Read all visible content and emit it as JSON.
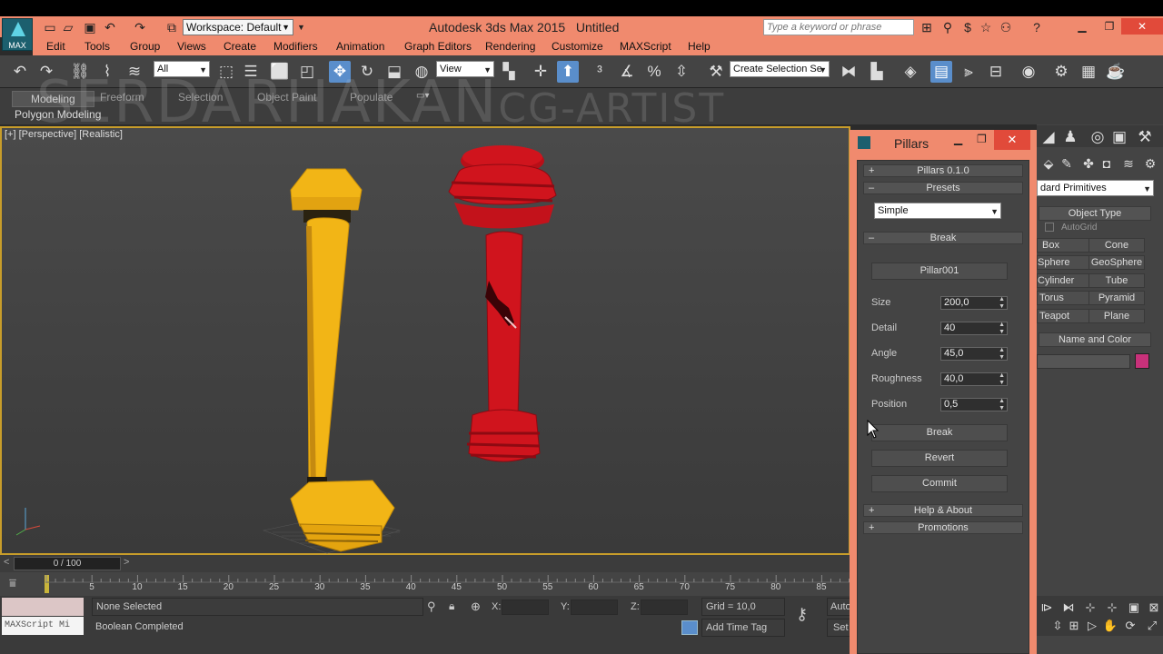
{
  "window": {
    "app_title": "Autodesk 3ds Max  2015",
    "doc_title": "Untitled",
    "logo_text": "MAX",
    "workspace": "Workspace: Default",
    "search_placeholder": "Type a keyword or phrase"
  },
  "menu": [
    "Edit",
    "Tools",
    "Group",
    "Views",
    "Create",
    "Modifiers",
    "Animation",
    "Graph Editors",
    "Rendering",
    "Customize",
    "MAXScript",
    "Help"
  ],
  "toolbar": {
    "selection_filter": "All",
    "ref_coord": "View",
    "named_selection": "Create Selection Se"
  },
  "ribbon": {
    "tabs": [
      "Modeling",
      "Freeform",
      "Selection",
      "Object Paint",
      "Populate"
    ],
    "subtab": "Polygon Modeling"
  },
  "watermark": {
    "main": "SERDARHAKAN",
    "sub": "CG-ARTIST"
  },
  "viewport": {
    "label": "[+] [Perspective] [Realistic]"
  },
  "timeline": {
    "frame_label": "0 / 100",
    "ticks": [
      "0",
      "5",
      "10",
      "15",
      "20",
      "25",
      "30",
      "35",
      "40",
      "45",
      "50",
      "55",
      "60",
      "65",
      "70",
      "75",
      "80",
      "85"
    ]
  },
  "status": {
    "selection": "None Selected",
    "message": "Boolean Completed",
    "x_label": "X:",
    "y_label": "Y:",
    "z_label": "Z:",
    "grid": "Grid = 10,0",
    "add_time_tag": "Add Time Tag",
    "auto": "Auto",
    "set": "Set",
    "maxscript": "MAXScript Mi"
  },
  "dialog": {
    "title": "Pillars",
    "rollouts": {
      "version": "Pillars 0.1.0",
      "presets": "Presets",
      "break": "Break",
      "help": "Help & About",
      "promotions": "Promotions"
    },
    "preset_value": "Simple",
    "pick_button": "Pillar001",
    "params": [
      {
        "label": "Size",
        "value": "200,0"
      },
      {
        "label": "Detail",
        "value": "40"
      },
      {
        "label": "Angle",
        "value": "45,0"
      },
      {
        "label": "Roughness",
        "value": "40,0"
      },
      {
        "label": "Position",
        "value": "0,5"
      }
    ],
    "buttons": {
      "break": "Break",
      "revert": "Revert",
      "commit": "Commit"
    }
  },
  "command_panel": {
    "category": "dard Primitives",
    "object_type": "Object Type",
    "autogrid": "AutoGrid",
    "primitives": [
      "Box",
      "Cone",
      "Sphere",
      "GeoSphere",
      "Cylinder",
      "Tube",
      "Torus",
      "Pyramid",
      "Teapot",
      "Plane"
    ],
    "name_and_color": "Name and Color",
    "object_color": "#c8317a"
  },
  "colors": {
    "title_bar": "#f08a6e",
    "viewport_border": "#c89d2a",
    "pillar_yellow": "#f2b516",
    "pillar_red": "#d0141d"
  }
}
